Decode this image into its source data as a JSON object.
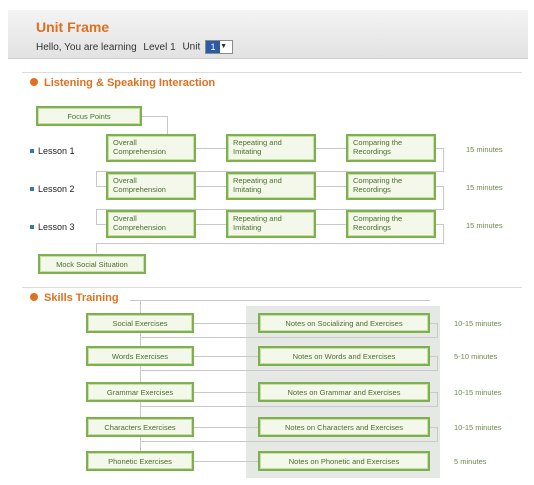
{
  "header": {
    "title": "Unit Frame",
    "hello": "Hello, You are learning",
    "level_label": "Level 1",
    "unit_label": "Unit",
    "unit_value": "1"
  },
  "listening": {
    "heading": "Listening & Speaking Interaction",
    "focus_points": "Focus Points",
    "mock_social": "Mock Social Situation",
    "lessons": [
      {
        "label": "Lesson 1",
        "step1": "Overall Comprehension",
        "step2": "Repeating and Imitating",
        "step3": "Comparing the Recordings",
        "minutes": "15 minutes"
      },
      {
        "label": "Lesson 2",
        "step1": "Overall Comprehension",
        "step2": "Repeating and Imitating",
        "step3": "Comparing the Recordings",
        "minutes": "15 minutes"
      },
      {
        "label": "Lesson 3",
        "step1": "Overall Comprehension",
        "step2": "Repeating and Imitating",
        "step3": "Comparing the Recordings",
        "minutes": "15 minutes"
      }
    ]
  },
  "skills": {
    "heading": "Skills Training",
    "rows": [
      {
        "exercise": "Social Exercises",
        "notes": "Notes on Socializing and Exercises",
        "minutes": "10-15 minutes"
      },
      {
        "exercise": "Words Exercises",
        "notes": "Notes on Words and Exercises",
        "minutes": "5-10 minutes"
      },
      {
        "exercise": "Grammar Exercises",
        "notes": "Notes on Grammar and Exercises",
        "minutes": "10-15 minutes"
      },
      {
        "exercise": "Characters Exercises",
        "notes": "Notes on Characters and Exercises",
        "minutes": "10-15 minutes"
      },
      {
        "exercise": "Phonetic Exercises",
        "notes": "Notes on Phonetic and Exercises",
        "minutes": "5 minutes"
      }
    ]
  },
  "colors": {
    "accent": "#e07020",
    "box_border": "#7fb04f",
    "box_fill": "#f3f8ea",
    "minutes_text": "#6b8a4a"
  }
}
